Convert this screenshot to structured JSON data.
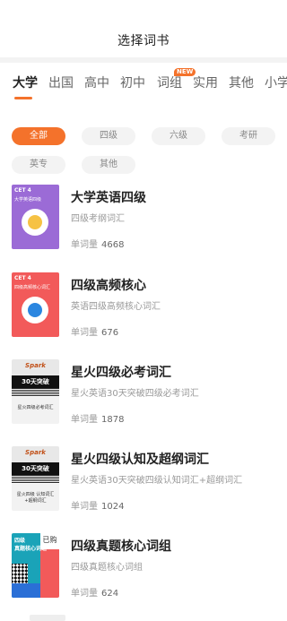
{
  "header": {
    "title": "选择词书"
  },
  "tabs": [
    {
      "label": "大学",
      "active": true
    },
    {
      "label": "出国"
    },
    {
      "label": "高中"
    },
    {
      "label": "初中"
    },
    {
      "label": "词组",
      "badge": "NEW"
    },
    {
      "label": "实用"
    },
    {
      "label": "其他"
    },
    {
      "label": "小学"
    }
  ],
  "filters": [
    {
      "label": "全部",
      "active": true
    },
    {
      "label": "四级"
    },
    {
      "label": "六级"
    },
    {
      "label": "考研"
    },
    {
      "label": "英专"
    },
    {
      "label": "其他"
    }
  ],
  "colors": {
    "accent": "#f4722b",
    "purple": "#9b6bd6",
    "red": "#f25a5a",
    "yellow": "#f6c244",
    "blue": "#2b86e0"
  },
  "count_label": "单词量",
  "books": [
    {
      "name": "大学英语四级",
      "desc": "四级考纲词汇",
      "count": "4668",
      "cover": {
        "type": "cet",
        "title": "CET 4",
        "subtitle": "大学英语四级",
        "bg": "#9b6bd6",
        "dot": "#f6c244"
      }
    },
    {
      "name": "四级高频核心",
      "desc": "英语四级高频核心词汇",
      "count": "676",
      "cover": {
        "type": "cet",
        "title": "CET 4",
        "subtitle": "四级高频核心词汇",
        "bg": "#f25a5a",
        "dot": "#2b86e0"
      }
    },
    {
      "name": "星火四级必考词汇",
      "desc": "星火英语30天突破四级必考词汇",
      "count": "1878",
      "cover": {
        "type": "spark",
        "logo": "Spark",
        "band": "30天突破",
        "bottom": "星火四级必考词汇"
      }
    },
    {
      "name": "星火四级认知及超纲词汇",
      "desc": "星火英语30天突破四级认知词汇+超纲词汇",
      "count": "1024",
      "cover": {
        "type": "spark",
        "logo": "Spark",
        "band": "30天突破",
        "bottom": "星火四级 认知词汇+超纲词汇"
      }
    },
    {
      "name": "四级真题核心词组",
      "desc": "四级真题核心词组",
      "count": "624",
      "cover": {
        "type": "zhenti",
        "line1": "四级",
        "line2": "真题核心词组",
        "owned": "已购"
      }
    }
  ]
}
